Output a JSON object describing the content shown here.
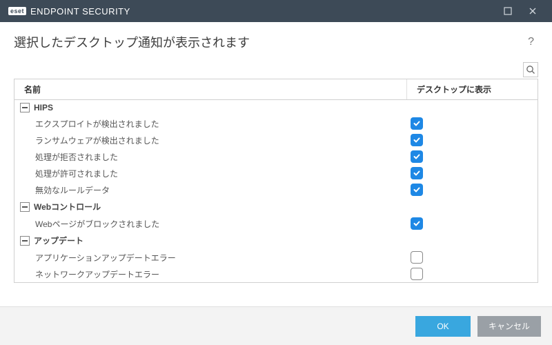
{
  "titlebar": {
    "brand_badge": "eset",
    "brand_text": "ENDPOINT SECURITY"
  },
  "page": {
    "title": "選択したデスクトップ通知が表示されます"
  },
  "columns": {
    "name": "名前",
    "desktop": "デスクトップに表示"
  },
  "groups": [
    {
      "label": "HIPS",
      "items": [
        {
          "name": "エクスプロイトが検出されました",
          "checked": true
        },
        {
          "name": "ランサムウェアが検出されました",
          "checked": true
        },
        {
          "name": "処理が拒否されました",
          "checked": true
        },
        {
          "name": "処理が許可されました",
          "checked": true
        },
        {
          "name": "無効なルールデータ",
          "checked": true
        }
      ]
    },
    {
      "label": "Webコントロール",
      "items": [
        {
          "name": "Webページがブロックされました",
          "checked": true
        }
      ]
    },
    {
      "label": "アップデート",
      "items": [
        {
          "name": "アプリケーションアップデートエラー",
          "checked": false
        },
        {
          "name": "ネットワークアップデートエラー",
          "checked": false
        }
      ]
    }
  ],
  "buttons": {
    "ok": "OK",
    "cancel": "キャンセル"
  }
}
